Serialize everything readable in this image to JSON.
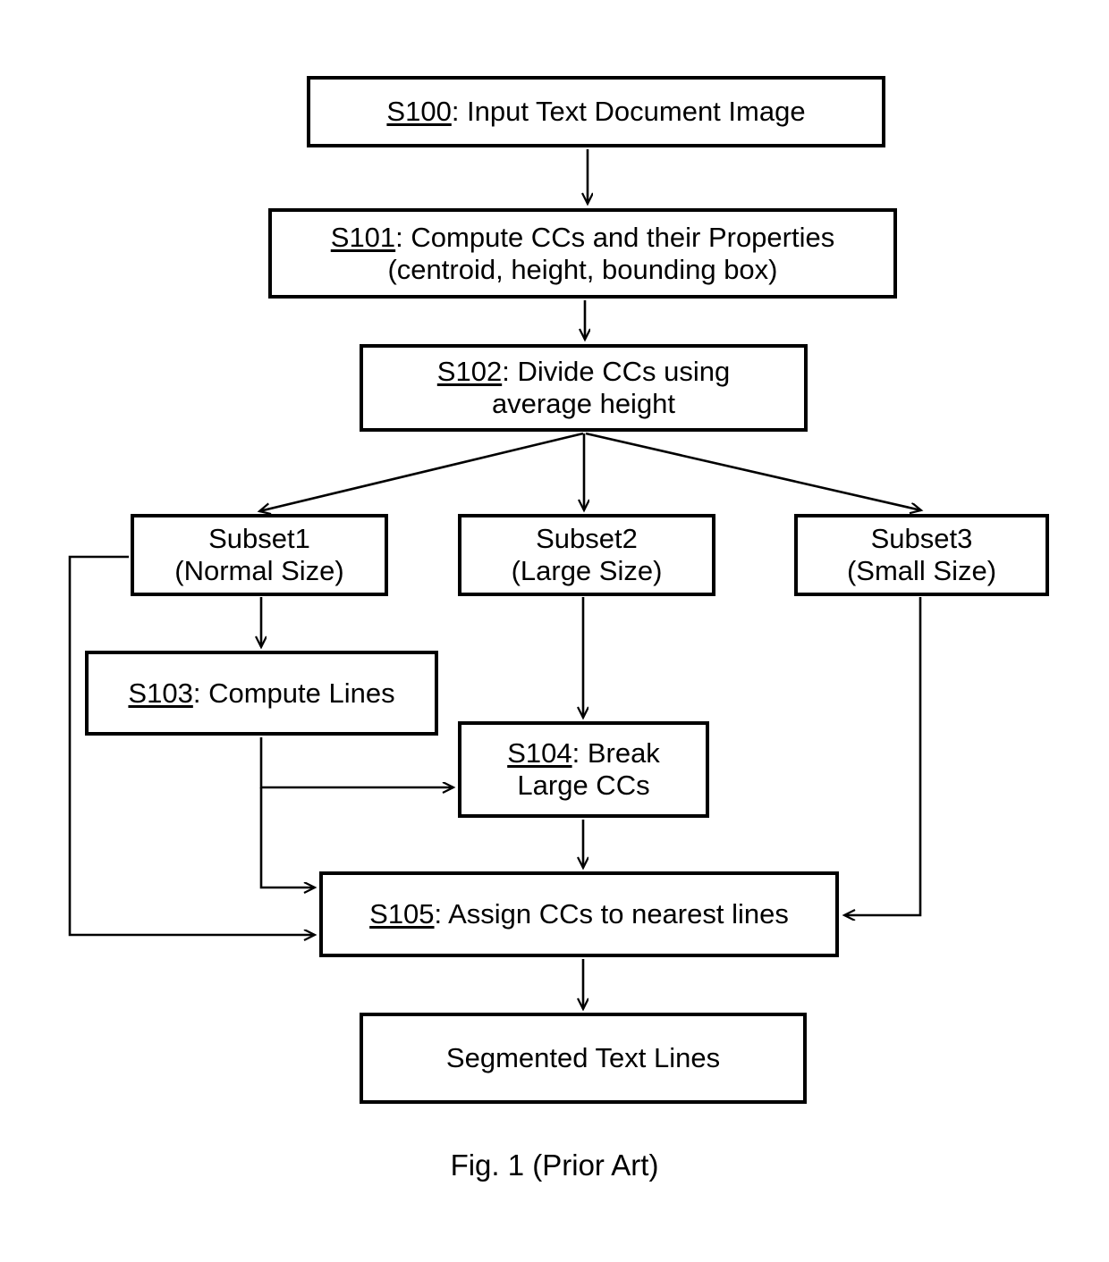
{
  "figure": {
    "caption": "Fig. 1 (Prior Art)",
    "type": "flowchart",
    "colors": {
      "background": "#ffffff",
      "stroke": "#000000",
      "text": "#000000"
    }
  },
  "nodes": {
    "s100": {
      "step": "S100",
      "sep": ": ",
      "text": "Input Text Document Image"
    },
    "s101": {
      "step": "S101",
      "sep": ": ",
      "text": "Compute CCs and their Properties",
      "line2": "(centroid, height, bounding box)"
    },
    "s102": {
      "step": "S102",
      "sep": ": ",
      "text": "Divide CCs using",
      "line2": "average height"
    },
    "subset1": {
      "line1": "Subset1",
      "line2": "(Normal Size)"
    },
    "subset2": {
      "line1": "Subset2",
      "line2": "(Large Size)"
    },
    "subset3": {
      "line1": "Subset3",
      "line2": "(Small Size)"
    },
    "s103": {
      "step": "S103",
      "sep": ": ",
      "text": "Compute Lines"
    },
    "s104": {
      "step": "S104",
      "sep": ": ",
      "text": "Break",
      "line2": "Large CCs"
    },
    "s105": {
      "step": "S105",
      "sep": ": ",
      "text": "Assign CCs to nearest lines"
    },
    "output": {
      "line1": "Segmented Text Lines"
    }
  },
  "edges": [
    {
      "id": "e-s100-s101",
      "from": "s100",
      "to": "s101",
      "kind": "straight-down-arrow"
    },
    {
      "id": "e-s101-s102",
      "from": "s101",
      "to": "s102",
      "kind": "straight-down-arrow"
    },
    {
      "id": "e-s102-subset1",
      "from": "s102",
      "to": "subset1",
      "kind": "diagonal-arrow"
    },
    {
      "id": "e-s102-subset2",
      "from": "s102",
      "to": "subset2",
      "kind": "straight-down-arrow"
    },
    {
      "id": "e-s102-subset3",
      "from": "s102",
      "to": "subset3",
      "kind": "diagonal-arrow"
    },
    {
      "id": "e-subset1-s103",
      "from": "subset1",
      "to": "s103",
      "kind": "straight-down-arrow"
    },
    {
      "id": "e-subset1-s105",
      "from": "subset1",
      "to": "s105",
      "kind": "left-bypass-arrow"
    },
    {
      "id": "e-subset2-s104",
      "from": "subset2",
      "to": "s104",
      "kind": "straight-down-arrow"
    },
    {
      "id": "e-subset3-s105",
      "from": "subset3",
      "to": "s105",
      "kind": "right-bypass-arrow"
    },
    {
      "id": "e-s103-s104",
      "from": "s103",
      "to": "s104",
      "kind": "elbow-arrow"
    },
    {
      "id": "e-s103-s105",
      "from": "s103",
      "to": "s105",
      "kind": "elbow-arrow"
    },
    {
      "id": "e-s104-s105",
      "from": "s104",
      "to": "s105",
      "kind": "straight-down-arrow"
    },
    {
      "id": "e-s105-output",
      "from": "s105",
      "to": "output",
      "kind": "straight-down-arrow"
    }
  ]
}
